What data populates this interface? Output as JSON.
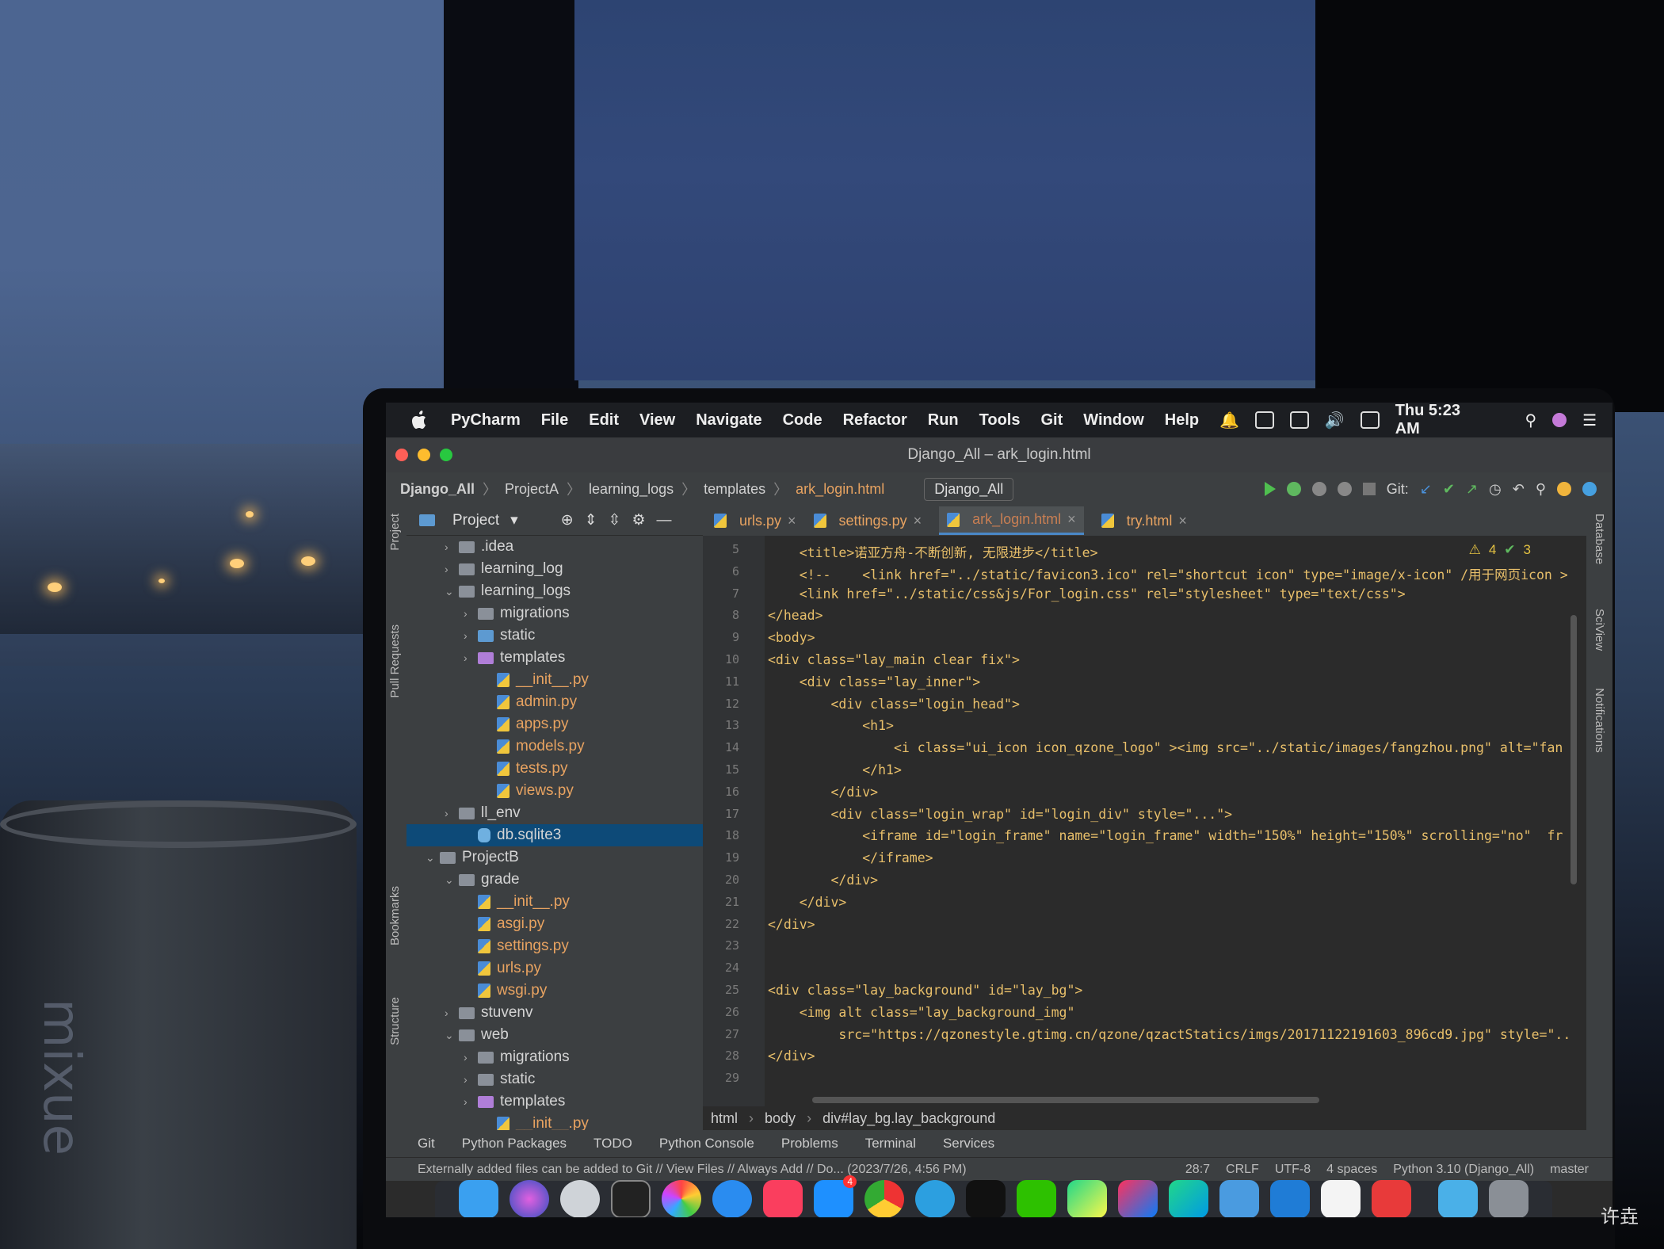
{
  "menubar": {
    "app": "PyCharm",
    "items": [
      "File",
      "Edit",
      "View",
      "Navigate",
      "Code",
      "Refactor",
      "Run",
      "Tools",
      "Git",
      "Window",
      "Help"
    ],
    "clock": "Thu 5:23 AM"
  },
  "window": {
    "title": "Django_All – ark_login.html"
  },
  "navbar": {
    "crumbs": [
      "Django_All",
      "ProjectA",
      "learning_logs",
      "templates"
    ],
    "file": "ark_login.html",
    "run_config": "Django_All",
    "git_label": "Git:"
  },
  "left_strip": {
    "project": "Project",
    "pull_requests": "Pull Requests",
    "bookmarks": "Bookmarks",
    "structure": "Structure"
  },
  "right_strip": {
    "database": "Database",
    "sciview": "SciView",
    "notifications": "Notifications"
  },
  "project": {
    "header": "Project",
    "tree": [
      {
        "label": ".idea",
        "type": "folder",
        "indent": 2,
        "arrow": "›"
      },
      {
        "label": "learning_log",
        "type": "folder",
        "indent": 2,
        "arrow": "›"
      },
      {
        "label": "learning_logs",
        "type": "folder",
        "indent": 2,
        "arrow": "⌄"
      },
      {
        "label": "migrations",
        "type": "folder",
        "indent": 3,
        "arrow": "›"
      },
      {
        "label": "static",
        "type": "folder-blue",
        "indent": 3,
        "arrow": "›"
      },
      {
        "label": "templates",
        "type": "folder-purple",
        "indent": 3,
        "arrow": "›"
      },
      {
        "label": "__init__.py",
        "type": "py",
        "indent": 4,
        "arrow": ""
      },
      {
        "label": "admin.py",
        "type": "py",
        "indent": 4,
        "arrow": ""
      },
      {
        "label": "apps.py",
        "type": "py",
        "indent": 4,
        "arrow": ""
      },
      {
        "label": "models.py",
        "type": "py",
        "indent": 4,
        "arrow": ""
      },
      {
        "label": "tests.py",
        "type": "py",
        "indent": 4,
        "arrow": ""
      },
      {
        "label": "views.py",
        "type": "py",
        "indent": 4,
        "arrow": ""
      },
      {
        "label": "ll_env",
        "type": "folder",
        "indent": 2,
        "arrow": "›"
      },
      {
        "label": "db.sqlite3",
        "type": "db",
        "indent": 3,
        "arrow": ""
      },
      {
        "label": "ProjectB",
        "type": "folder",
        "indent": 1,
        "arrow": "⌄"
      },
      {
        "label": "grade",
        "type": "folder",
        "indent": 2,
        "arrow": "⌄"
      },
      {
        "label": "__init__.py",
        "type": "py",
        "indent": 3,
        "arrow": ""
      },
      {
        "label": "asgi.py",
        "type": "py",
        "indent": 3,
        "arrow": ""
      },
      {
        "label": "settings.py",
        "type": "py",
        "indent": 3,
        "arrow": ""
      },
      {
        "label": "urls.py",
        "type": "py",
        "indent": 3,
        "arrow": ""
      },
      {
        "label": "wsgi.py",
        "type": "py",
        "indent": 3,
        "arrow": ""
      },
      {
        "label": "stuvenv",
        "type": "folder",
        "indent": 2,
        "arrow": "›"
      },
      {
        "label": "web",
        "type": "folder",
        "indent": 2,
        "arrow": "⌄"
      },
      {
        "label": "migrations",
        "type": "folder",
        "indent": 3,
        "arrow": "›"
      },
      {
        "label": "static",
        "type": "folder",
        "indent": 3,
        "arrow": "›"
      },
      {
        "label": "templates",
        "type": "folder-purple",
        "indent": 3,
        "arrow": "›"
      },
      {
        "label": "__init__.py",
        "type": "py",
        "indent": 4,
        "arrow": ""
      }
    ],
    "selected": "db.sqlite3"
  },
  "tabs": [
    {
      "label": "urls.py",
      "active": false
    },
    {
      "label": "settings.py",
      "active": false
    },
    {
      "label": "ark_login.html",
      "active": true
    },
    {
      "label": "try.html",
      "active": false
    }
  ],
  "editor": {
    "warnings": "4",
    "checks": "3",
    "lines": [
      {
        "n": "5",
        "text": "    <title>诺亚方舟-不断创新, 无限进步</title>"
      },
      {
        "n": "6",
        "text": "    <!--    <link href=\"../static/favicon3.ico\" rel=\"shortcut icon\" type=\"image/x-icon\" /用于网页icon >"
      },
      {
        "n": "7",
        "text": "    <link href=\"../static/css&js/For_login.css\" rel=\"stylesheet\" type=\"text/css\">"
      },
      {
        "n": "8",
        "text": "</head>"
      },
      {
        "n": "9",
        "text": "<body>"
      },
      {
        "n": "10",
        "text": "<div class=\"lay_main clear fix\">"
      },
      {
        "n": "11",
        "text": "    <div class=\"lay_inner\">"
      },
      {
        "n": "12",
        "text": "        <div class=\"login_head\">"
      },
      {
        "n": "13",
        "text": "            <h1>"
      },
      {
        "n": "14",
        "text": "                <i class=\"ui_icon icon_qzone_logo\" ><img src=\"../static/images/fangzhou.png\" alt=\"fan"
      },
      {
        "n": "15",
        "text": "            </h1>"
      },
      {
        "n": "16",
        "text": "        </div>"
      },
      {
        "n": "17",
        "text": "        <div class=\"login_wrap\" id=\"login_div\" style=\"...\">"
      },
      {
        "n": "18",
        "text": "            <iframe id=\"login_frame\" name=\"login_frame\" width=\"150%\" height=\"150%\" scrolling=\"no\"  fr"
      },
      {
        "n": "19",
        "text": "            </iframe>"
      },
      {
        "n": "20",
        "text": "        </div>"
      },
      {
        "n": "21",
        "text": "    </div>"
      },
      {
        "n": "22",
        "text": "</div>"
      },
      {
        "n": "23",
        "text": ""
      },
      {
        "n": "24",
        "text": ""
      },
      {
        "n": "25",
        "text": "<div class=\"lay_background\" id=\"lay_bg\">"
      },
      {
        "n": "26",
        "text": "    <img alt class=\"lay_background_img\""
      },
      {
        "n": "27",
        "text": "         src=\"https://qzonestyle.gtimg.cn/qzone/qzactStatics/imgs/20171122191603_896cd9.jpg\" style=\".."
      },
      {
        "n": "28",
        "text": "</div>"
      },
      {
        "n": "29",
        "text": ""
      }
    ]
  },
  "breadcrumbs": [
    "html",
    "body",
    "div#lay_bg.lay_background"
  ],
  "toolwindows": [
    "Git",
    "Python Packages",
    "TODO",
    "Python Console",
    "Problems",
    "Terminal",
    "Services"
  ],
  "status": {
    "message": "Externally added files can be added to Git // View Files // Always Add // Do... (2023/7/26, 4:56 PM)",
    "position": "28:7",
    "line_sep": "CRLF",
    "encoding": "UTF-8",
    "indent": "4 spaces",
    "interpreter": "Python 3.10 (Django_All)",
    "branch": "master"
  },
  "watermark": "许垚",
  "dock_badge": "4"
}
